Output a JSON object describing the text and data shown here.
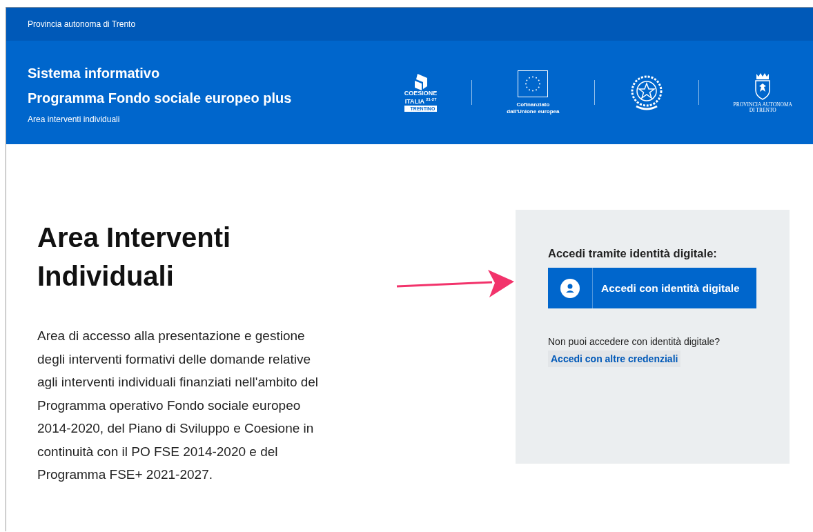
{
  "top_bar": {
    "label": "Provincia autonoma di Trento"
  },
  "header": {
    "title_lines": [
      "Sistema informativo",
      "Programma Fondo sociale europeo plus"
    ],
    "subtitle": "Area interventi individuali",
    "logos": [
      {
        "kind": "coesione",
        "texts": [
          "COESIONE",
          "ITALIA",
          "21-27",
          "TRENTINO"
        ]
      },
      {
        "kind": "eu",
        "texts": [
          "Cofinanziato",
          "dall'Unione europea"
        ]
      },
      {
        "kind": "emblem"
      },
      {
        "kind": "province",
        "texts": [
          "PROVINCIA AUTONOMA",
          "DI TRENTO"
        ]
      }
    ]
  },
  "main": {
    "title": "Area Interventi Individuali",
    "description": "Area di accesso alla presentazione e gestione degli interventi formativi delle domande relative agli interventi individuali finanziati nell'ambito del Programma operativo Fondo sociale europeo 2014-2020, del Piano di Sviluppo e Coesione in continuità con il PO FSE 2014-2020 e del Programma FSE+ 2021-2027."
  },
  "login": {
    "heading": "Accedi tramite identità digitale:",
    "button": "Accedi con identità digitale",
    "question": "Non puoi accedere con identità digitale?",
    "link": "Accedi con altre credenziali"
  }
}
